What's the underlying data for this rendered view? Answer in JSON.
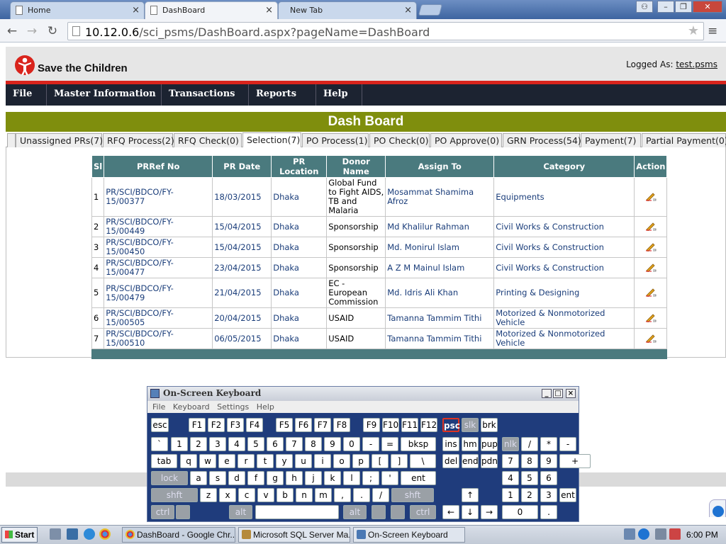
{
  "browser": {
    "tabs": [
      {
        "label": "Home",
        "close": "×"
      },
      {
        "label": "DashBoard",
        "close": "×"
      },
      {
        "label": "New Tab",
        "close": "×"
      }
    ],
    "url_host": "10.12.0.6",
    "url_path": "/sci_psms/DashBoard.aspx?pageName=DashBoard"
  },
  "app": {
    "brand": "Save the Children",
    "logged_label": "Logged As:",
    "user": "test.psms",
    "menu": [
      "File",
      "Master Information",
      "Transactions",
      "Reports",
      "Help"
    ],
    "title": "Dash Board",
    "tabs": [
      "Unassigned PRs(7)",
      "RFQ Process(2)",
      "RFQ Check(0)",
      "Selection(7)",
      "PO Process(1)",
      "PO Check(0)",
      "PO Approve(0)",
      "GRN Process(54)",
      "Payment(7)",
      "Partial Payment(0)"
    ],
    "active_tab": "Selection(7)",
    "columns": [
      "Sl",
      "PRRef No",
      "PR Date",
      "PR Location",
      "Donor Name",
      "Assign To",
      "Category",
      "Action"
    ],
    "rows": [
      {
        "sl": "1",
        "ref": "PR/SCI/BDCO/FY-15/00377",
        "date": "18/03/2015",
        "loc": "Dhaka",
        "donor": "Global Fund to Fight AIDS, TB and Malaria",
        "assign": "Mosammat Shamima Afroz",
        "cat": "Equipments"
      },
      {
        "sl": "2",
        "ref": "PR/SCI/BDCO/FY-15/00449",
        "date": "15/04/2015",
        "loc": "Dhaka",
        "donor": "Sponsorship",
        "assign": "Md Khalilur Rahman",
        "cat": "Civil Works & Construction"
      },
      {
        "sl": "3",
        "ref": "PR/SCI/BDCO/FY-15/00450",
        "date": "15/04/2015",
        "loc": "Dhaka",
        "donor": "Sponsorship",
        "assign": "Md. Monirul Islam",
        "cat": "Civil Works & Construction"
      },
      {
        "sl": "4",
        "ref": "PR/SCI/BDCO/FY-15/00477",
        "date": "23/04/2015",
        "loc": "Dhaka",
        "donor": "Sponsorship",
        "assign": "A Z M Mainul Islam",
        "cat": "Civil Works & Construction"
      },
      {
        "sl": "5",
        "ref": "PR/SCI/BDCO/FY-15/00479",
        "date": "21/04/2015",
        "loc": "Dhaka",
        "donor": "EC - European Commission",
        "assign": "Md. Idris Ali Khan",
        "cat": "Printing & Designing"
      },
      {
        "sl": "6",
        "ref": "PR/SCI/BDCO/FY-15/00505",
        "date": "20/04/2015",
        "loc": "Dhaka",
        "donor": "USAID",
        "assign": "Tamanna Tammim Tithi",
        "cat": "Motorized & Nonmotorized Vehicle"
      },
      {
        "sl": "7",
        "ref": "PR/SCI/BDCO/FY-15/00510",
        "date": "06/05/2015",
        "loc": "Dhaka",
        "donor": "USAID",
        "assign": "Tamanna Tammim Tithi",
        "cat": "Motorized & Nonmotorized Vehicle"
      }
    ]
  },
  "osk": {
    "title": "On-Screen Keyboard",
    "menu": [
      "File",
      "Keyboard",
      "Settings",
      "Help"
    ],
    "win_buttons": [
      "_",
      "□",
      "×"
    ],
    "keys": [
      [
        "esc",
        "F1",
        "F2",
        "F3",
        "F4",
        "F5",
        "F6",
        "F7",
        "F8",
        "F9",
        "F10",
        "F11",
        "F12",
        "psc",
        "slk",
        "brk"
      ],
      [
        "`",
        "1",
        "2",
        "3",
        "4",
        "5",
        "6",
        "7",
        "8",
        "9",
        "0",
        "-",
        "=",
        "bksp",
        "ins",
        "hm",
        "pup",
        "nlk",
        "/",
        "*",
        "-"
      ],
      [
        "tab",
        "q",
        "w",
        "e",
        "r",
        "t",
        "y",
        "u",
        "i",
        "o",
        "p",
        "[",
        "]",
        "\\",
        "del",
        "end",
        "pdn",
        "7",
        "8",
        "9",
        "+"
      ],
      [
        "lock",
        "a",
        "s",
        "d",
        "f",
        "g",
        "h",
        "j",
        "k",
        "l",
        ";",
        "'",
        "ent",
        "4",
        "5",
        "6"
      ],
      [
        "shft",
        "z",
        "x",
        "c",
        "v",
        "b",
        "n",
        "m",
        ",",
        ".",
        "/",
        "shft",
        "↑",
        "1",
        "2",
        "3",
        "ent"
      ],
      [
        "ctrl",
        "alt",
        "alt",
        "ctrl",
        "←",
        "↓",
        "→",
        "0",
        "."
      ]
    ]
  },
  "taskbar": {
    "start": "Start",
    "items": [
      "DashBoard - Google Chr...",
      "Microsoft SQL Server Ma...",
      "On-Screen Keyboard"
    ],
    "clock": "6:00 PM"
  }
}
